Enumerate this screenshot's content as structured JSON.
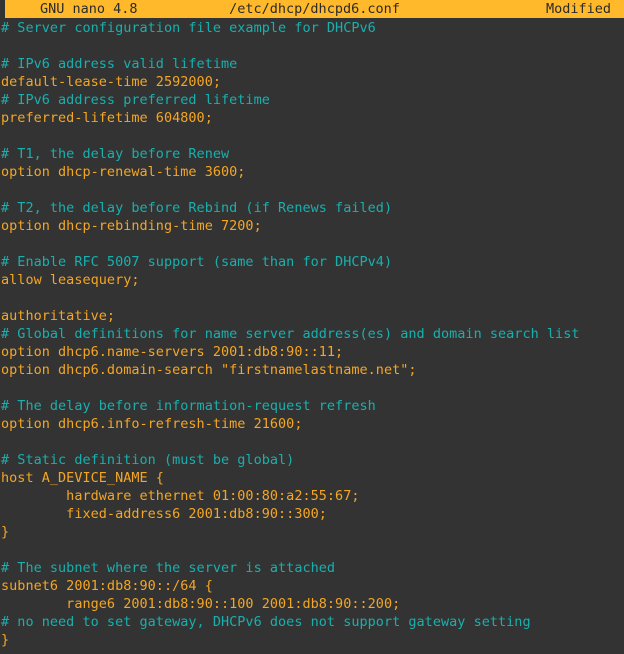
{
  "titlebar": {
    "app_name": "GNU nano 4.8",
    "file_path": "/etc/dhcp/dhcpd6.conf",
    "status": "Modified",
    "bg_color": "#ffb92b",
    "fg_color": "#2b2b2b"
  },
  "editor": {
    "background_color": "#333333",
    "comment_color": "#18b0ae",
    "code_color": "#f5a623",
    "lines": [
      {
        "text": "# Server configuration file example for DHCPv6",
        "kind": "comment"
      },
      {
        "text": "",
        "kind": "blank"
      },
      {
        "text": "# IPv6 address valid lifetime",
        "kind": "comment"
      },
      {
        "text": "default-lease-time 2592000;",
        "kind": "code"
      },
      {
        "text": "# IPv6 address preferred lifetime",
        "kind": "comment"
      },
      {
        "text": "preferred-lifetime 604800;",
        "kind": "code"
      },
      {
        "text": "",
        "kind": "blank"
      },
      {
        "text": "# T1, the delay before Renew",
        "kind": "comment"
      },
      {
        "text": "option dhcp-renewal-time 3600;",
        "kind": "code"
      },
      {
        "text": "",
        "kind": "blank"
      },
      {
        "text": "# T2, the delay before Rebind (if Renews failed)",
        "kind": "comment"
      },
      {
        "text": "option dhcp-rebinding-time 7200;",
        "kind": "code"
      },
      {
        "text": "",
        "kind": "blank"
      },
      {
        "text": "# Enable RFC 5007 support (same than for DHCPv4)",
        "kind": "comment"
      },
      {
        "text": "allow leasequery;",
        "kind": "code"
      },
      {
        "text": "",
        "kind": "blank"
      },
      {
        "text": "authoritative;",
        "kind": "code"
      },
      {
        "text": "# Global definitions for name server address(es) and domain search list",
        "kind": "comment"
      },
      {
        "text": "option dhcp6.name-servers 2001:db8:90::11;",
        "kind": "code"
      },
      {
        "text": "option dhcp6.domain-search \"firstnamelastname.net\";",
        "kind": "code"
      },
      {
        "text": "",
        "kind": "blank"
      },
      {
        "text": "# The delay before information-request refresh",
        "kind": "comment"
      },
      {
        "text": "option dhcp6.info-refresh-time 21600;",
        "kind": "code"
      },
      {
        "text": "",
        "kind": "blank"
      },
      {
        "text": "# Static definition (must be global)",
        "kind": "comment"
      },
      {
        "text": "host A_DEVICE_NAME {",
        "kind": "code"
      },
      {
        "text": "        hardware ethernet 01:00:80:a2:55:67;",
        "kind": "code"
      },
      {
        "text": "        fixed-address6 2001:db8:90::300;",
        "kind": "code"
      },
      {
        "text": "}",
        "kind": "code"
      },
      {
        "text": "",
        "kind": "blank"
      },
      {
        "text": "# The subnet where the server is attached",
        "kind": "comment"
      },
      {
        "text": "subnet6 2001:db8:90::/64 {",
        "kind": "code"
      },
      {
        "text": "        range6 2001:db8:90::100 2001:db8:90::200;",
        "kind": "code"
      },
      {
        "text": "# no need to set gateway, DHCPv6 does not support gateway setting",
        "kind": "comment"
      },
      {
        "text": "}",
        "kind": "code"
      }
    ]
  }
}
